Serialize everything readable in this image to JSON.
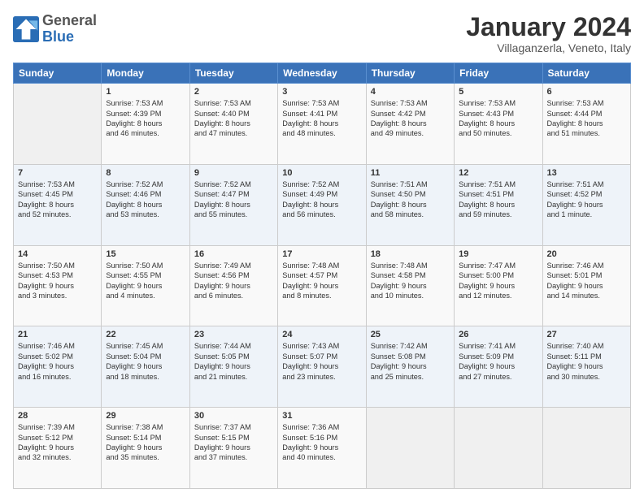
{
  "header": {
    "logo_general": "General",
    "logo_blue": "Blue",
    "title": "January 2024",
    "subtitle": "Villaganzerla, Veneto, Italy"
  },
  "columns": [
    "Sunday",
    "Monday",
    "Tuesday",
    "Wednesday",
    "Thursday",
    "Friday",
    "Saturday"
  ],
  "weeks": [
    [
      {
        "day": "",
        "content": ""
      },
      {
        "day": "1",
        "content": "Sunrise: 7:53 AM\nSunset: 4:39 PM\nDaylight: 8 hours\nand 46 minutes."
      },
      {
        "day": "2",
        "content": "Sunrise: 7:53 AM\nSunset: 4:40 PM\nDaylight: 8 hours\nand 47 minutes."
      },
      {
        "day": "3",
        "content": "Sunrise: 7:53 AM\nSunset: 4:41 PM\nDaylight: 8 hours\nand 48 minutes."
      },
      {
        "day": "4",
        "content": "Sunrise: 7:53 AM\nSunset: 4:42 PM\nDaylight: 8 hours\nand 49 minutes."
      },
      {
        "day": "5",
        "content": "Sunrise: 7:53 AM\nSunset: 4:43 PM\nDaylight: 8 hours\nand 50 minutes."
      },
      {
        "day": "6",
        "content": "Sunrise: 7:53 AM\nSunset: 4:44 PM\nDaylight: 8 hours\nand 51 minutes."
      }
    ],
    [
      {
        "day": "7",
        "content": "Sunrise: 7:53 AM\nSunset: 4:45 PM\nDaylight: 8 hours\nand 52 minutes."
      },
      {
        "day": "8",
        "content": "Sunrise: 7:52 AM\nSunset: 4:46 PM\nDaylight: 8 hours\nand 53 minutes."
      },
      {
        "day": "9",
        "content": "Sunrise: 7:52 AM\nSunset: 4:47 PM\nDaylight: 8 hours\nand 55 minutes."
      },
      {
        "day": "10",
        "content": "Sunrise: 7:52 AM\nSunset: 4:49 PM\nDaylight: 8 hours\nand 56 minutes."
      },
      {
        "day": "11",
        "content": "Sunrise: 7:51 AM\nSunset: 4:50 PM\nDaylight: 8 hours\nand 58 minutes."
      },
      {
        "day": "12",
        "content": "Sunrise: 7:51 AM\nSunset: 4:51 PM\nDaylight: 8 hours\nand 59 minutes."
      },
      {
        "day": "13",
        "content": "Sunrise: 7:51 AM\nSunset: 4:52 PM\nDaylight: 9 hours\nand 1 minute."
      }
    ],
    [
      {
        "day": "14",
        "content": "Sunrise: 7:50 AM\nSunset: 4:53 PM\nDaylight: 9 hours\nand 3 minutes."
      },
      {
        "day": "15",
        "content": "Sunrise: 7:50 AM\nSunset: 4:55 PM\nDaylight: 9 hours\nand 4 minutes."
      },
      {
        "day": "16",
        "content": "Sunrise: 7:49 AM\nSunset: 4:56 PM\nDaylight: 9 hours\nand 6 minutes."
      },
      {
        "day": "17",
        "content": "Sunrise: 7:48 AM\nSunset: 4:57 PM\nDaylight: 9 hours\nand 8 minutes."
      },
      {
        "day": "18",
        "content": "Sunrise: 7:48 AM\nSunset: 4:58 PM\nDaylight: 9 hours\nand 10 minutes."
      },
      {
        "day": "19",
        "content": "Sunrise: 7:47 AM\nSunset: 5:00 PM\nDaylight: 9 hours\nand 12 minutes."
      },
      {
        "day": "20",
        "content": "Sunrise: 7:46 AM\nSunset: 5:01 PM\nDaylight: 9 hours\nand 14 minutes."
      }
    ],
    [
      {
        "day": "21",
        "content": "Sunrise: 7:46 AM\nSunset: 5:02 PM\nDaylight: 9 hours\nand 16 minutes."
      },
      {
        "day": "22",
        "content": "Sunrise: 7:45 AM\nSunset: 5:04 PM\nDaylight: 9 hours\nand 18 minutes."
      },
      {
        "day": "23",
        "content": "Sunrise: 7:44 AM\nSunset: 5:05 PM\nDaylight: 9 hours\nand 21 minutes."
      },
      {
        "day": "24",
        "content": "Sunrise: 7:43 AM\nSunset: 5:07 PM\nDaylight: 9 hours\nand 23 minutes."
      },
      {
        "day": "25",
        "content": "Sunrise: 7:42 AM\nSunset: 5:08 PM\nDaylight: 9 hours\nand 25 minutes."
      },
      {
        "day": "26",
        "content": "Sunrise: 7:41 AM\nSunset: 5:09 PM\nDaylight: 9 hours\nand 27 minutes."
      },
      {
        "day": "27",
        "content": "Sunrise: 7:40 AM\nSunset: 5:11 PM\nDaylight: 9 hours\nand 30 minutes."
      }
    ],
    [
      {
        "day": "28",
        "content": "Sunrise: 7:39 AM\nSunset: 5:12 PM\nDaylight: 9 hours\nand 32 minutes."
      },
      {
        "day": "29",
        "content": "Sunrise: 7:38 AM\nSunset: 5:14 PM\nDaylight: 9 hours\nand 35 minutes."
      },
      {
        "day": "30",
        "content": "Sunrise: 7:37 AM\nSunset: 5:15 PM\nDaylight: 9 hours\nand 37 minutes."
      },
      {
        "day": "31",
        "content": "Sunrise: 7:36 AM\nSunset: 5:16 PM\nDaylight: 9 hours\nand 40 minutes."
      },
      {
        "day": "",
        "content": ""
      },
      {
        "day": "",
        "content": ""
      },
      {
        "day": "",
        "content": ""
      }
    ]
  ]
}
